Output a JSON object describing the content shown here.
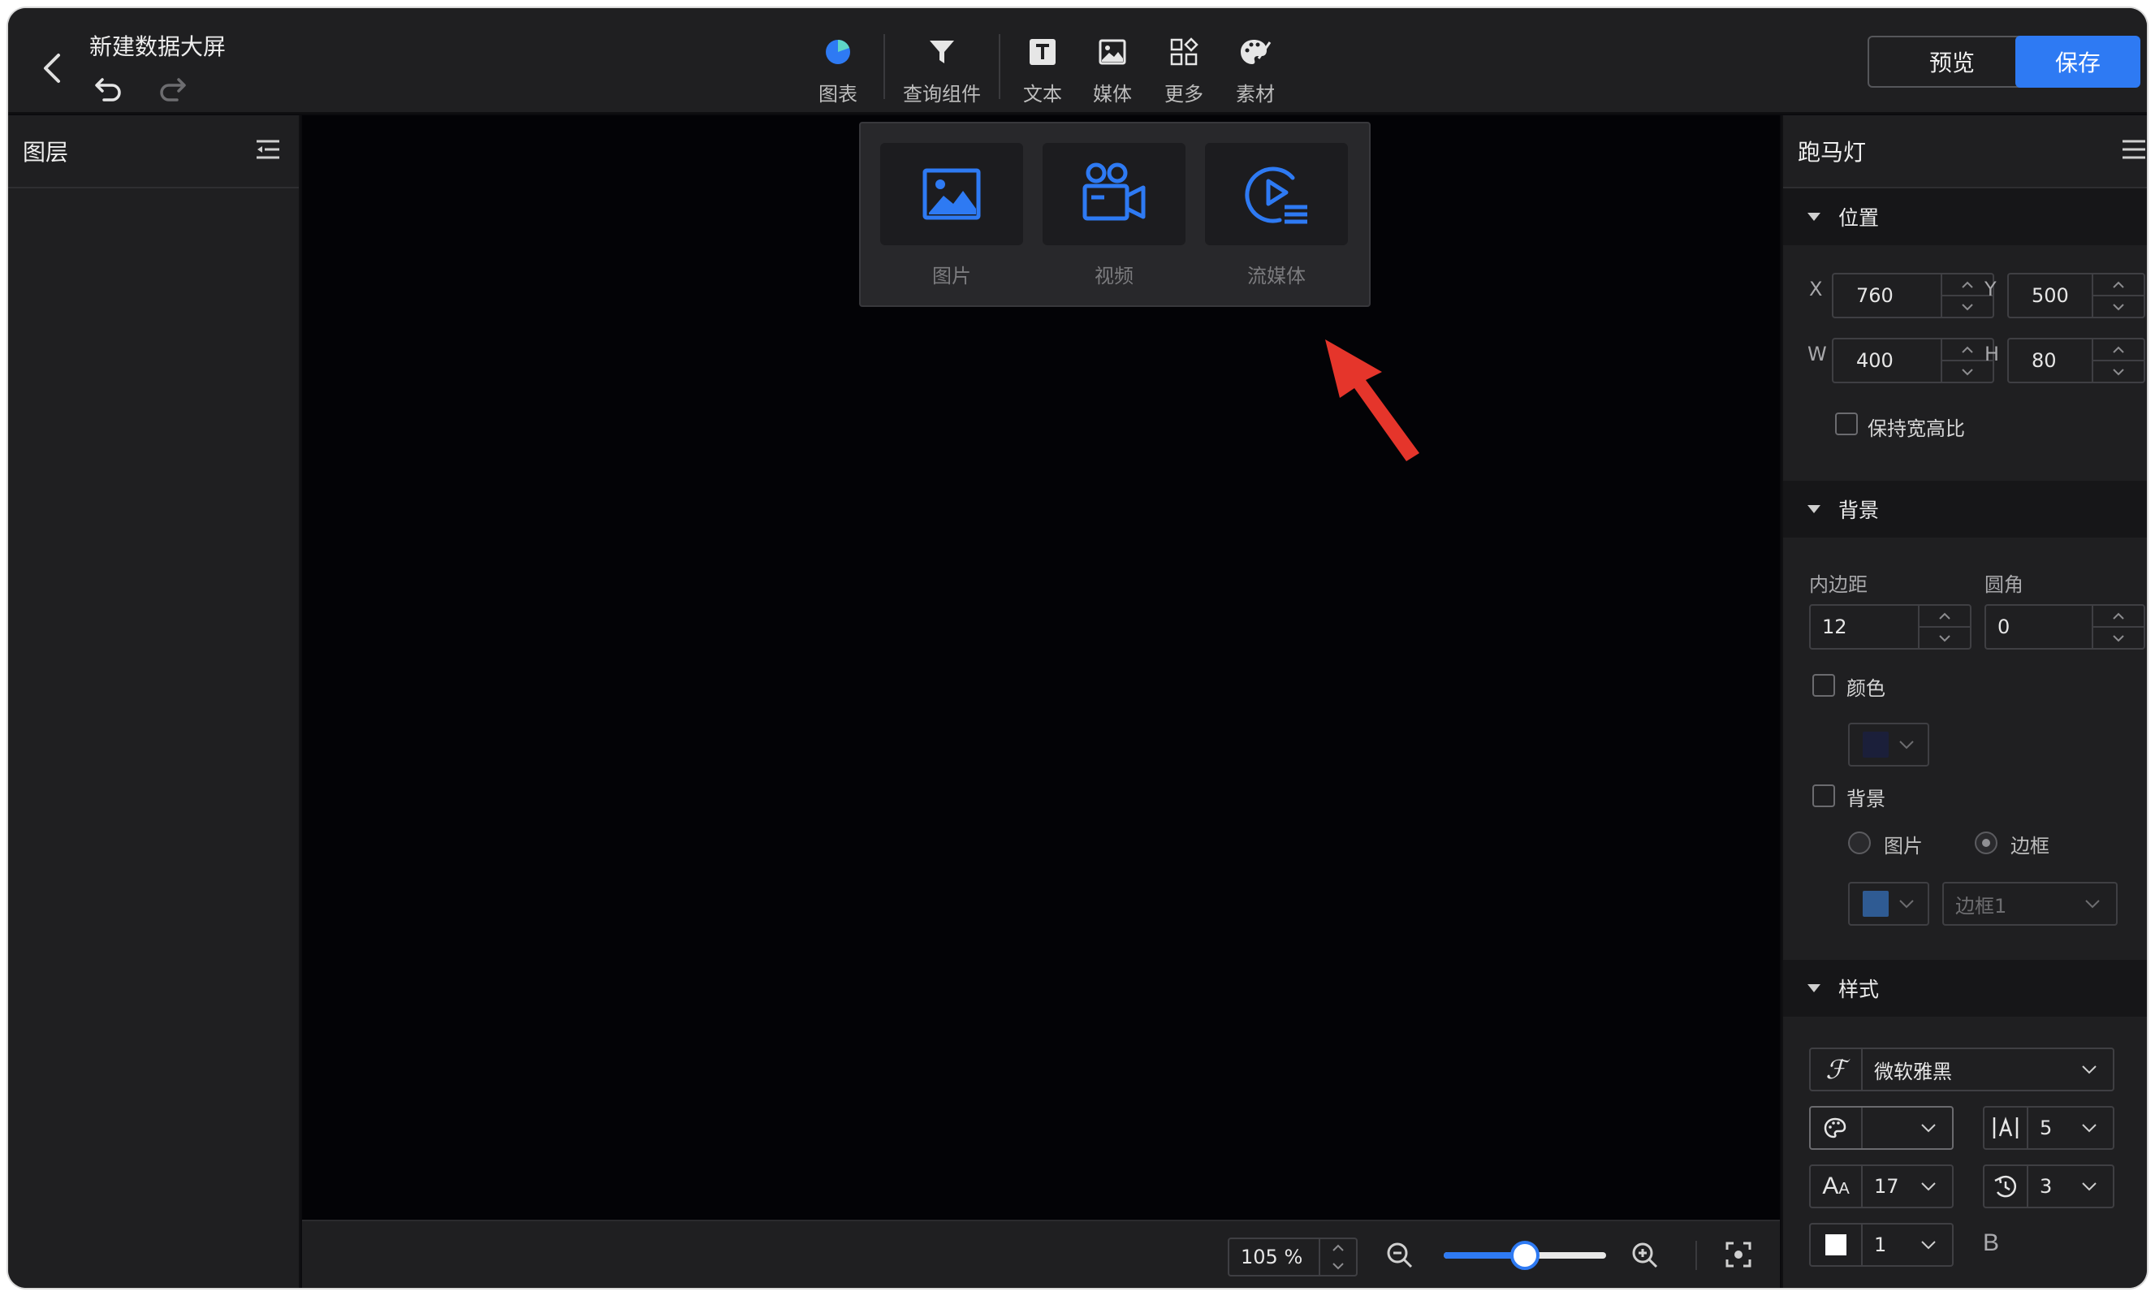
{
  "header": {
    "title": "新建数据大屏",
    "tools": [
      {
        "label": "图表",
        "icon": "pie-chart-icon"
      },
      {
        "label": "查询组件",
        "icon": "filter-icon"
      },
      {
        "label": "文本",
        "icon": "text-icon"
      },
      {
        "label": "媒体",
        "icon": "image-icon"
      },
      {
        "label": "更多",
        "icon": "grid-icon"
      },
      {
        "label": "素材",
        "icon": "palette-icon"
      }
    ],
    "preview_label": "预览",
    "save_label": "保存"
  },
  "layers_panel": {
    "title": "图层"
  },
  "media_popup": {
    "items": [
      {
        "label": "图片",
        "icon": "image-icon"
      },
      {
        "label": "视频",
        "icon": "video-camera-icon"
      },
      {
        "label": "流媒体",
        "icon": "stream-play-icon"
      }
    ]
  },
  "bottom_bar": {
    "zoom_value": "105",
    "zoom_unit": "%",
    "zoom_slider_fraction": 0.5
  },
  "properties": {
    "title": "跑马灯",
    "position": {
      "title": "位置",
      "x_label": "X",
      "x": "760",
      "y_label": "Y",
      "y": "500",
      "w_label": "W",
      "w": "400",
      "h_label": "H",
      "h": "80",
      "keep_ratio_label": "保持宽高比"
    },
    "background": {
      "title": "背景",
      "padding_label": "内边距",
      "padding": "12",
      "radius_label": "圆角",
      "radius": "0",
      "color_label": "颜色",
      "color_swatch": "#1b1f3a",
      "bg_label": "背景",
      "radio_image": "图片",
      "radio_border": "边框",
      "border_swatch": "#2f5b93",
      "border_style": "边框1"
    },
    "style": {
      "title": "样式",
      "font": "微软雅黑",
      "letter_spacing": "5",
      "font_size": "17",
      "speed": "3",
      "line_value": "1",
      "bold_label": "B"
    }
  },
  "colors": {
    "accent": "#2e7af3",
    "annotation_arrow": "#e5352b"
  }
}
